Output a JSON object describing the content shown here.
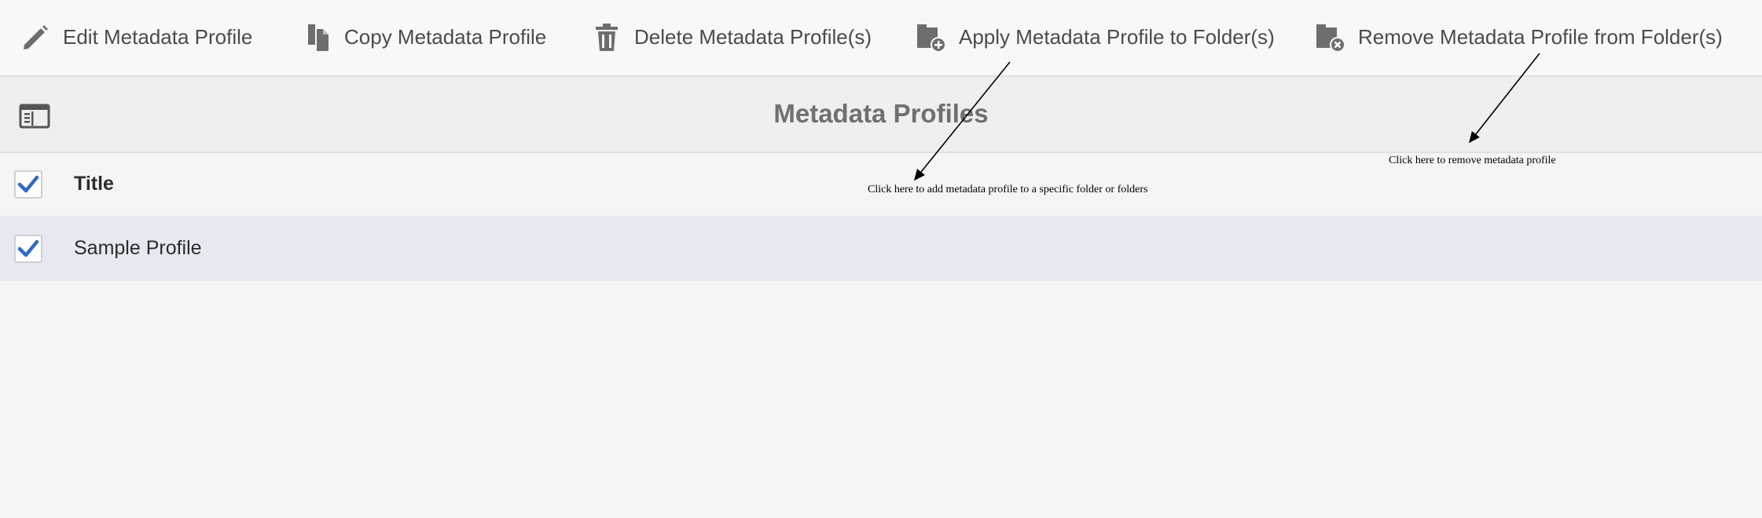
{
  "toolbar": {
    "edit_label": "Edit Metadata Profile",
    "copy_label": "Copy Metadata Profile",
    "delete_label": "Delete Metadata Profile(s)",
    "apply_label": "Apply Metadata Profile to Folder(s)",
    "remove_label": "Remove Metadata Profile from Folder(s)"
  },
  "icons": {
    "edit": "pencil-icon",
    "copy": "copy-icon",
    "delete": "trash-icon",
    "apply": "folder-add-icon",
    "remove": "folder-remove-icon",
    "rail": "rail-toggle-icon",
    "check": "checkmark-icon"
  },
  "page": {
    "title": "Metadata Profiles"
  },
  "table": {
    "header": {
      "title": "Title",
      "select_all_checked": true
    },
    "rows": [
      {
        "title": "Sample Profile",
        "checked": true
      }
    ]
  },
  "annotations": {
    "apply_note": "Click here to add metadata profile to a specific folder or folders",
    "remove_note": "Click here to remove metadata profile"
  },
  "colors": {
    "checkmark": "#2d6bc4",
    "icon": "#6e6e6e",
    "selected_row": "#e6e9f0"
  }
}
